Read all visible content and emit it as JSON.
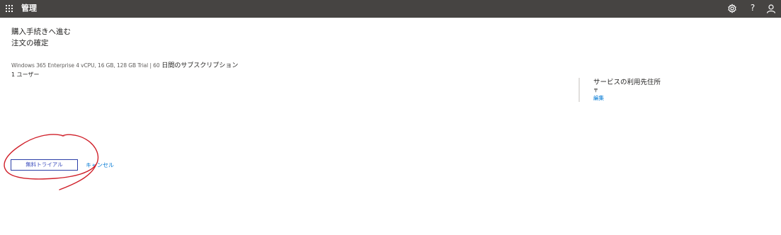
{
  "header": {
    "app_title": "管理",
    "icons": [
      "waffle-icon",
      "gear-icon",
      "help-icon",
      "user-icon"
    ],
    "help_glyph": "?",
    "bar_color": "#464442"
  },
  "main": {
    "breadcrumb": "購入手続きへ進む",
    "title": "注文の確定",
    "product_latin": "Windows 365 Enterprise 4 vCPU, 16 GB, 128 GB Trial | 60",
    "product_jp": " 日間のサブスクリプション",
    "users": "1 ユーザー"
  },
  "side_panel": {
    "heading": "サービスの利用先住所",
    "postal_mark": "〒",
    "edit_link": "編集"
  },
  "actions": {
    "trial_button": "無料トライアル",
    "cancel_link": "キャンセル"
  },
  "annotation": {
    "shape": "hand-drawn-circle",
    "color": "#d0202a"
  }
}
